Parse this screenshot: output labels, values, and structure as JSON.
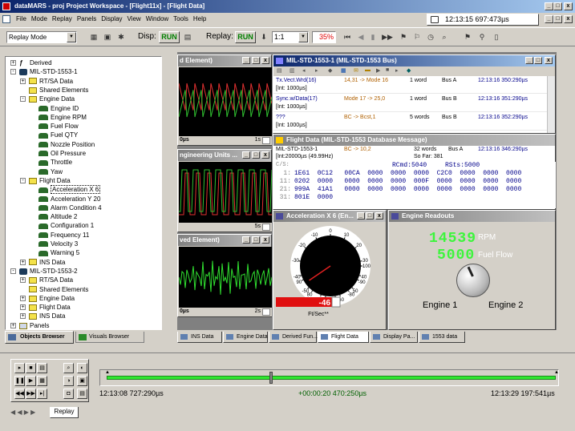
{
  "app": {
    "title": "dataMARS - proj Project Workspace - [Flight11x] - [Flight Data]"
  },
  "menu": [
    "File",
    "Mode",
    "Replay",
    "Panels",
    "Display",
    "View",
    "Window",
    "Tools",
    "Help"
  ],
  "clock": "12:13:15 697:473µs",
  "toolbar": {
    "mode_value": "Replay Mode",
    "disp_label": "Disp:",
    "disp_run": "RUN",
    "replay_label": "Replay:",
    "replay_run": "RUN",
    "speed_value": "1:1",
    "percent": "35%"
  },
  "tree": {
    "items": [
      {
        "label": "Derived",
        "level": 0,
        "icon": "derived-icon",
        "exp": "+"
      },
      {
        "label": "MIL-STD-1553-1",
        "level": 0,
        "icon": "bus-icon",
        "exp": "-"
      },
      {
        "label": "RT/SA Data",
        "level": 1,
        "icon": "folder-icon",
        "exp": "+"
      },
      {
        "label": "Shared Elements",
        "level": 1,
        "icon": "folder-icon",
        "exp": ""
      },
      {
        "label": "Engine Data",
        "level": 1,
        "icon": "folder-icon",
        "exp": "-"
      },
      {
        "label": "Engine ID",
        "level": 2,
        "icon": "signal-icon",
        "exp": ""
      },
      {
        "label": "Engine RPM",
        "level": 2,
        "icon": "signal-icon",
        "exp": ""
      },
      {
        "label": "Fuel Flow",
        "level": 2,
        "icon": "signal-icon",
        "exp": ""
      },
      {
        "label": "Fuel QTY",
        "level": 2,
        "icon": "signal-icon",
        "exp": ""
      },
      {
        "label": "Nozzle Position",
        "level": 2,
        "icon": "signal-icon",
        "exp": ""
      },
      {
        "label": "Oil Pressure",
        "level": 2,
        "icon": "signal-icon",
        "exp": ""
      },
      {
        "label": "Throttle",
        "level": 2,
        "icon": "signal-icon",
        "exp": ""
      },
      {
        "label": "Yaw",
        "level": 2,
        "icon": "signal-icon",
        "exp": ""
      },
      {
        "label": "Flight Data",
        "level": 1,
        "icon": "folder-icon",
        "exp": "-"
      },
      {
        "label": "Acceleration X 6",
        "level": 2,
        "icon": "signal-icon",
        "exp": "",
        "selected": true
      },
      {
        "label": "Acceleration Y 20",
        "level": 2,
        "icon": "signal-icon",
        "exp": ""
      },
      {
        "label": "Alarm Condition 4",
        "level": 2,
        "icon": "signal-icon",
        "exp": ""
      },
      {
        "label": "Altitude 2",
        "level": 2,
        "icon": "signal-icon",
        "exp": ""
      },
      {
        "label": "Configuration 1",
        "level": 2,
        "icon": "signal-icon",
        "exp": ""
      },
      {
        "label": "Frequency 11",
        "level": 2,
        "icon": "signal-icon",
        "exp": ""
      },
      {
        "label": "Velocity 3",
        "level": 2,
        "icon": "signal-icon",
        "exp": ""
      },
      {
        "label": "Warning 5",
        "level": 2,
        "icon": "signal-icon",
        "exp": ""
      },
      {
        "label": "INS Data",
        "level": 1,
        "icon": "folder-icon",
        "exp": "+"
      },
      {
        "label": "MIL-STD-1553-2",
        "level": 0,
        "icon": "bus-icon",
        "exp": "-"
      },
      {
        "label": "RT/SA Data",
        "level": 1,
        "icon": "folder-icon",
        "exp": "+"
      },
      {
        "label": "Shared Elements",
        "level": 1,
        "icon": "folder-icon",
        "exp": ""
      },
      {
        "label": "Engine Data",
        "level": 1,
        "icon": "folder-icon",
        "exp": "+"
      },
      {
        "label": "Flight Data",
        "level": 1,
        "icon": "folder-icon",
        "exp": "+"
      },
      {
        "label": "INS Data",
        "level": 1,
        "icon": "folder-icon",
        "exp": "+"
      },
      {
        "label": "Panels",
        "level": 0,
        "icon": "panels-icon",
        "exp": "+"
      }
    ],
    "tabs": [
      "Objects Browser",
      "Visuals Browser"
    ]
  },
  "plots": [
    {
      "title": "d Element)",
      "time_label": "0µs",
      "range": "1s"
    },
    {
      "title": "ngineering Units ...",
      "time_label": "",
      "range": "5s"
    },
    {
      "title": "ved Element)",
      "time_label": "0µs",
      "range": "2s"
    }
  ],
  "bus_window": {
    "title": "MIL-STD-1553-1 (MIL-STD-1553 Bus)",
    "rows": [
      {
        "name": "Tx.Vect.Wrd(16)",
        "val": "14,31 -> Mode 16",
        "words": "1 word",
        "bus": "Bus A",
        "time": "12:13:16 350:290µs",
        "int": "[Int: 1000µs]"
      },
      {
        "name": "Sync.w/Data(17)",
        "val": "Mode 17 -> 25,0",
        "words": "1 word",
        "bus": "Bus B",
        "time": "12:13:16 351:290µs",
        "int": "[Int: 1000µs]"
      },
      {
        "name": "???",
        "val": "BC -> Bcst,1",
        "words": "5 words",
        "bus": "Bus B",
        "time": "12:13:16 352:290µs",
        "int": "[Int: 1000µs]"
      }
    ]
  },
  "flight_window": {
    "title": "Flight Data (MIL-STD-1553 Database Message)",
    "line1": {
      "bus": "MIL-STD-1553-1",
      "route": "BC -> 10,2",
      "words": "32 words",
      "busab": "Bus A",
      "time": "12:13:16 346:290µs"
    },
    "line2": {
      "int": "[Int:20000µs (49.99Hz)",
      "sofar": "So Far: 381"
    },
    "hdr": {
      "cs": "C/S:",
      "rcmd": "RCmd:5040",
      "rsts": "RSts:5000"
    },
    "hex": [
      {
        "n": "1:",
        "d": "1E61  0C12   00CA  0000  0000  0000  C2C0  0000  0000  0000"
      },
      {
        "n": "11:",
        "d": "0202  0000   0000  0000  0000  000F  0000  0000  0000  0000"
      },
      {
        "n": "21:",
        "d": "999A  41A1   0000  0000  0000  0000  0000  0000  0000  0000"
      },
      {
        "n": "31:",
        "d": "801E  0000"
      }
    ]
  },
  "gauge": {
    "title": "Acceleration X 6 (En...",
    "value": "-46",
    "unit": "Ft/Sec**",
    "ticks": [
      "0",
      "-10",
      "-20",
      "-30",
      "-40",
      "-50",
      "-60",
      "-70",
      "-80",
      "-90",
      "-100",
      "10",
      "20",
      "30",
      "40",
      "50",
      "60",
      "70",
      "80",
      "90"
    ],
    "needle_value": -46
  },
  "engine": {
    "title": "Engine Readouts",
    "rpm": "14539",
    "rpm_label": "RPM",
    "fuel": "5000",
    "fuel_label": "Fuel Flow",
    "eng1": "Engine 1",
    "eng2": "Engine 2"
  },
  "bottom_tabs": [
    "INS Data",
    "Engine Data",
    "Derived Fun...",
    "Flight Data",
    "Display Pa...",
    "1553 data"
  ],
  "timeline": {
    "start": "12:13:08 727:290µs",
    "mid": "+00:00:20 470:250µs",
    "end": "12:13:29 197:541µs",
    "tab": "Replay",
    "progress": 0.35
  },
  "colors": {
    "titlebar": "#0a246a",
    "lcd": "#3df53d",
    "run": "#00a000"
  }
}
